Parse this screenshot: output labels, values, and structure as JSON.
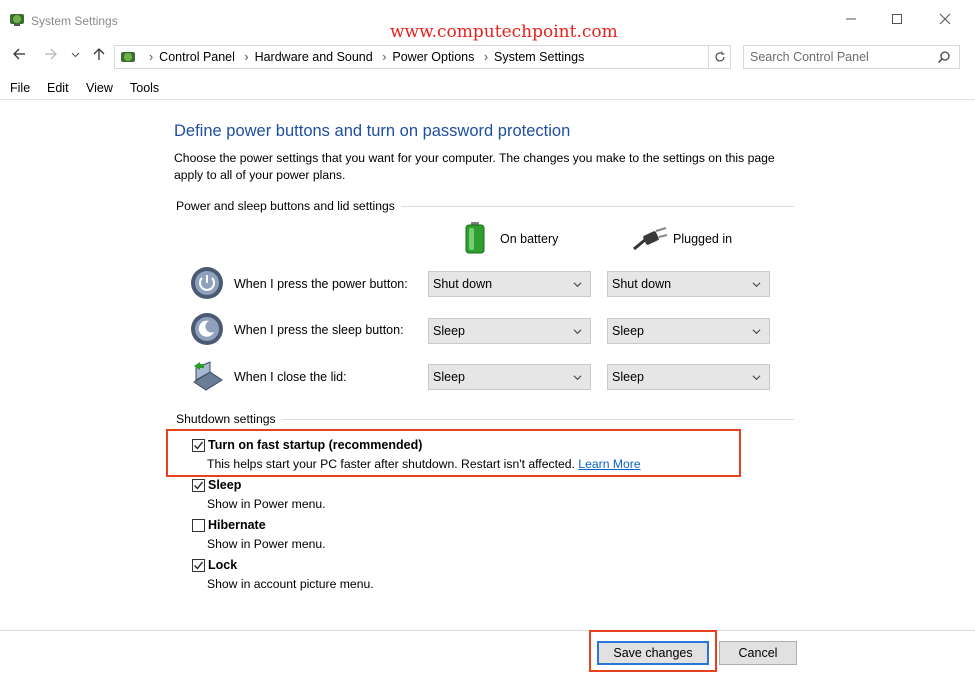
{
  "window": {
    "title": "System Settings",
    "watermark": "www.computechpoint.com"
  },
  "address": {
    "crumbs": [
      "Control Panel",
      "Hardware and Sound",
      "Power Options",
      "System Settings"
    ],
    "search_placeholder": "Search Control Panel"
  },
  "menu": [
    "File",
    "Edit",
    "View",
    "Tools"
  ],
  "page": {
    "heading": "Define power buttons and turn on password protection",
    "description": "Choose the power settings that you want for your computer. The changes you make to the settings on this page apply to all of your power plans.",
    "section_power": "Power and sleep buttons and lid settings",
    "col_battery": "On battery",
    "col_plugged": "Plugged in",
    "rows": [
      {
        "label": "When I press the power button:",
        "battery": "Shut down",
        "plugged": "Shut down"
      },
      {
        "label": "When I press the sleep button:",
        "battery": "Sleep",
        "plugged": "Sleep"
      },
      {
        "label": "When I close the lid:",
        "battery": "Sleep",
        "plugged": "Sleep"
      }
    ],
    "section_shutdown": "Shutdown settings",
    "options": [
      {
        "title": "Turn on fast startup (recommended)",
        "desc": "This helps start your PC faster after shutdown. Restart isn't affected.",
        "link": "Learn More",
        "checked": true
      },
      {
        "title": "Sleep",
        "desc": "Show in Power menu.",
        "checked": true
      },
      {
        "title": "Hibernate",
        "desc": "Show in Power menu.",
        "checked": false
      },
      {
        "title": "Lock",
        "desc": "Show in account picture menu.",
        "checked": true
      }
    ]
  },
  "buttons": {
    "save": "Save changes",
    "cancel": "Cancel"
  },
  "colors": {
    "heading": "#1e4fa0",
    "highlight": "#e8401c",
    "link": "#0a63c9",
    "watermark": "#e8211c"
  }
}
